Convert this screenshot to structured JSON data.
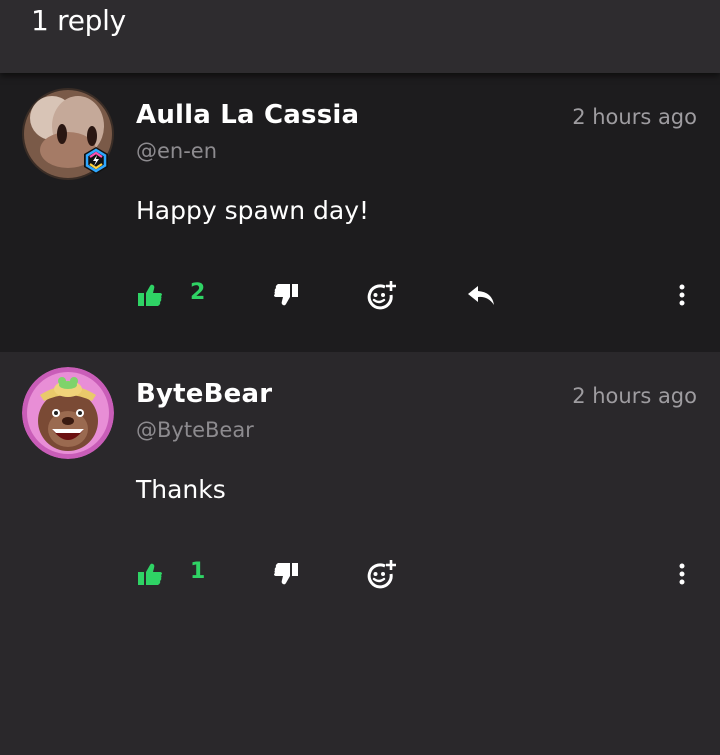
{
  "header": {
    "title": "1 reply"
  },
  "comments": [
    {
      "author": "Aulla La Cassia",
      "handle": "@en-en",
      "time": "2 hours ago",
      "text": "Happy spawn day!",
      "likes": "2",
      "has_reply": true,
      "badge_icon": "hexagon-badge-icon"
    },
    {
      "author": "ByteBear",
      "handle": "@ByteBear",
      "time": "2 hours ago",
      "text": "Thanks",
      "likes": "1",
      "has_reply": false
    }
  ],
  "colors": {
    "accent_green": "#2fd365",
    "background": "#2a282b",
    "highlight_bg": "#1d1c1e"
  },
  "icons": [
    "thumbs-up-icon",
    "thumbs-down-icon",
    "add-emoji-icon",
    "reply-arrow-icon",
    "more-vertical-icon"
  ]
}
